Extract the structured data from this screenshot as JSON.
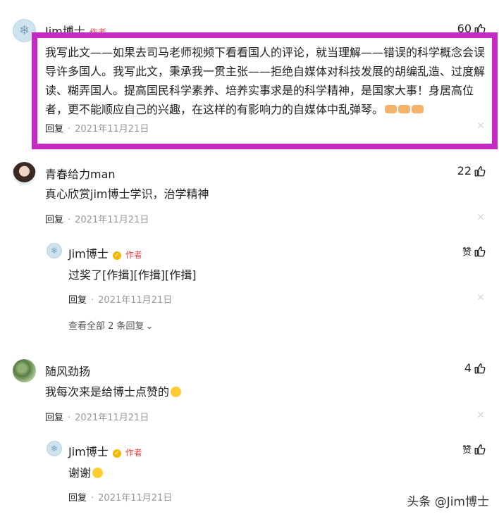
{
  "comments": [
    {
      "author": "Jim博士",
      "author_tag": "作者",
      "likes": "60",
      "text": "我写此文——如果去司马老师视频下看看国人的评论，就当理解——错误的科学概念会误导许多国人。我写此文，秉承我一贯主张——拒绝自媒体对科技发展的胡编乱造、过度解读、糊弄国人。提高国民科学素养、培养实事求是的科学精神，是国家大事！身居高位者，更不能顺应自己的兴趣，在这样的有影响力的自媒体中乱弹琴。",
      "reply_label": "回复",
      "date": "2021年11月21日"
    },
    {
      "author": "青春给力man",
      "likes": "22",
      "text": "真心欣赏jim博士学识，治学精神",
      "reply_label": "回复",
      "date": "2021年11月21日",
      "reply": {
        "author": "Jim博士",
        "author_tag": "作者",
        "likes": "赞",
        "text": "过奖了[作揖][作揖][作揖]",
        "reply_label": "回复",
        "date": "2021年11月21日"
      },
      "expand_label": "查看全部 2 条回复"
    },
    {
      "author": "随风劲扬",
      "likes": "4",
      "text": "我每次来是给博士点赞的",
      "reply_label": "回复",
      "date": "2021年11月21日",
      "reply": {
        "author": "Jim博士",
        "author_tag": "作者",
        "likes": "赞",
        "text": "谢谢",
        "reply_label": "回复",
        "date": "2021年11月21日"
      }
    }
  ],
  "watermark": "头条 @Jim博士",
  "highlight_color": "#c629c4",
  "author_tag_color": "#f04142",
  "icons": [
    "snowflake-avatar",
    "thumb-up-icon",
    "close-icon",
    "chevron-down-icon",
    "verified-icon"
  ]
}
